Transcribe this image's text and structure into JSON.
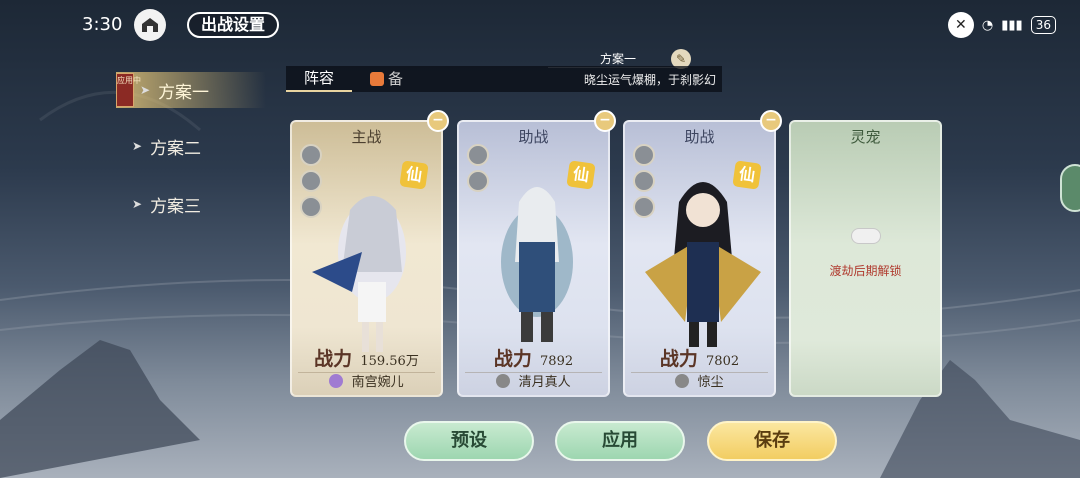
{
  "status_bar": {
    "time": "3:30",
    "battery": "36"
  },
  "header": {
    "title": "出战设置"
  },
  "plan_nav": {
    "applied_tag": "应用中",
    "items": [
      {
        "label": "方案一"
      },
      {
        "label": "方案二"
      },
      {
        "label": "方案三"
      }
    ]
  },
  "tabs": [
    {
      "label": "阵容"
    },
    {
      "label": "备"
    }
  ],
  "plan_info": {
    "title": "方案一",
    "description": "晓尘运气爆棚，于刹影幻"
  },
  "cards": [
    {
      "role": "主战",
      "power_label": "战力",
      "power": "159.56万",
      "name": "南宫婉儿",
      "grade": "仙"
    },
    {
      "role": "助战",
      "power_label": "战力",
      "power": "7892",
      "name": "清月真人",
      "grade": "仙"
    },
    {
      "role": "助战",
      "power_label": "战力",
      "power": "7802",
      "name": "惊尘",
      "grade": "仙"
    },
    {
      "role": "灵宠",
      "locked_text": "渡劫后期解锁"
    }
  ],
  "buttons": {
    "preset": "预设",
    "apply": "应用",
    "save": "保存"
  },
  "colors": {
    "gold_card": "#efe6d2",
    "blue_card": "#e2e6f2",
    "green_card": "#dde8d8",
    "save_button": "#f2cd62",
    "green_button": "#9dd6b0"
  }
}
